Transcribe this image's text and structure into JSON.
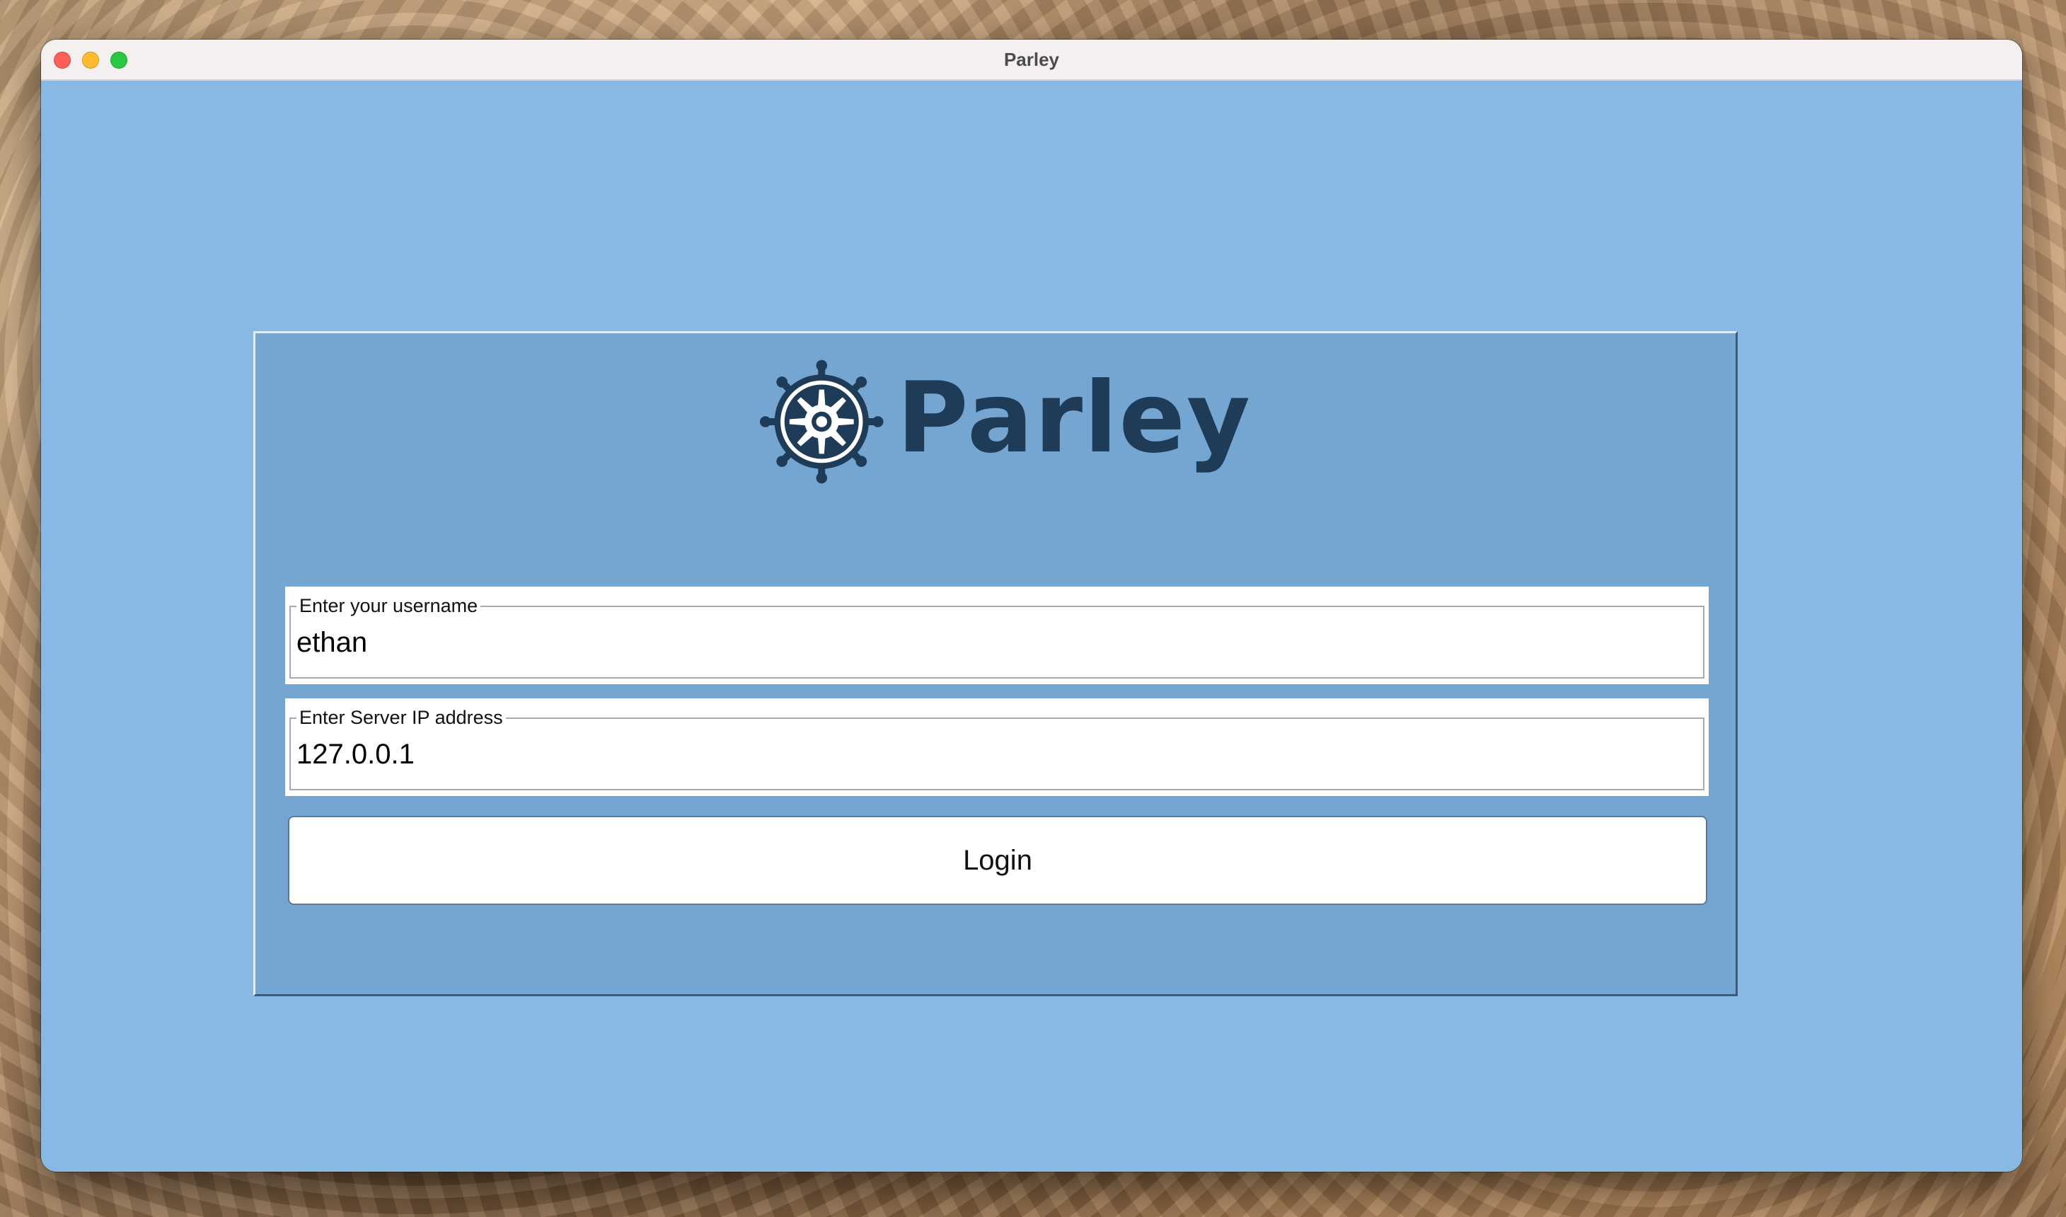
{
  "window": {
    "title": "Parley"
  },
  "logo": {
    "text": "Parley",
    "icon": "ship-wheel-icon",
    "color": "#1e3c58"
  },
  "form": {
    "username": {
      "label": "Enter your username",
      "value": "ethan"
    },
    "server_ip": {
      "label": "Enter Server IP address",
      "value": "127.0.0.1"
    },
    "login_label": "Login"
  },
  "colors": {
    "window_background": "#87b9e3",
    "panel_background": "#75a6d1",
    "titlebar": "#f3f0ef"
  }
}
